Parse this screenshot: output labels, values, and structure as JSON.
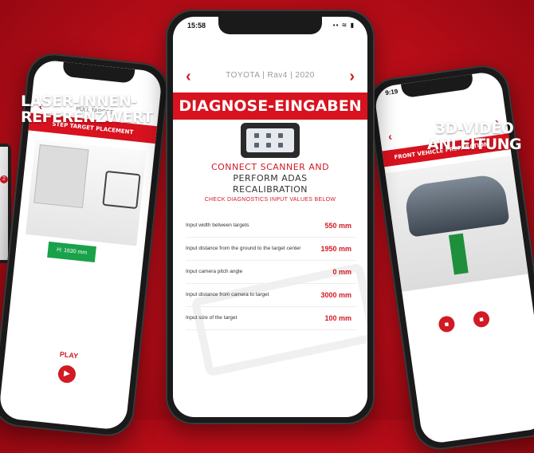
{
  "center": {
    "time": "15:58",
    "status_icons": "▪▪ ≋ ▮",
    "vehicle": "TOYOTA | Rav4 | 2020",
    "title": "DIAGNOSE-EINGABEN",
    "headline_1": "CONNECT SCANNER AND",
    "headline_2": "PERFORM ADAS",
    "headline_3": "RECALIBRATION",
    "subline": "CHECK DIAGNOSTICS INPUT VALUES BELOW",
    "rows": [
      {
        "label": "Input width between targets",
        "value": "550 mm"
      },
      {
        "label": "Input distance from the ground to the target center",
        "value": "1950 mm"
      },
      {
        "label": "Input camera pitch angle",
        "value": "0 mm"
      },
      {
        "label": "Input distance from camera to target",
        "value": "3000 mm"
      },
      {
        "label": "Input size of the target",
        "value": "100 mm"
      }
    ]
  },
  "left": {
    "caption_1": "LASER-INNEN-",
    "caption_2": "REFERENZWERT",
    "header": "PULL TARGET",
    "redbar": "STEP TARGET PLACEMENT",
    "green_value": "H: 1630 mm",
    "play_label": "PLAY"
  },
  "right": {
    "caption_1": "3D-VIDEO",
    "caption_2": "ANLEITUNG",
    "time": "9:19",
    "redbar": "FRONT VEHICLE PREPARATION"
  },
  "icons": {
    "prev": "‹",
    "next": "›",
    "play": "▶"
  },
  "colors": {
    "brand_red": "#d8121f",
    "green": "#19a24a"
  }
}
